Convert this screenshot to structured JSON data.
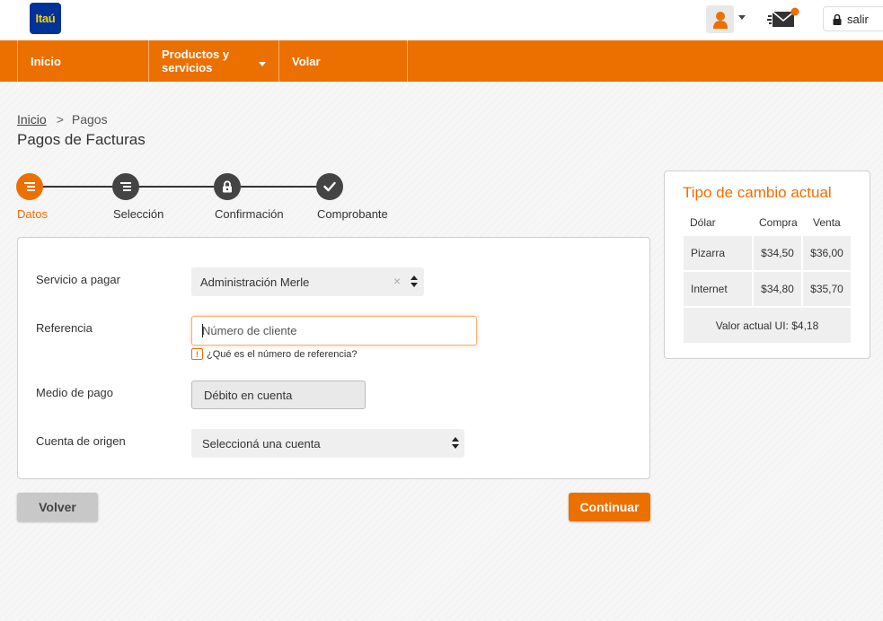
{
  "header": {
    "logo_text": "Itaú",
    "logout_label": "salir",
    "notification_color": "#ec7000"
  },
  "nav": {
    "items": [
      {
        "label": "Inicio"
      },
      {
        "label": "Productos y servicios",
        "has_dropdown": true
      },
      {
        "label": "Volar"
      }
    ]
  },
  "breadcrumb": {
    "home": "Inicio",
    "separator": ">",
    "current": "Pagos"
  },
  "page_title": "Pagos de Facturas",
  "stepper": {
    "steps": [
      {
        "label": "Datos",
        "icon": "list-icon",
        "active": true
      },
      {
        "label": "Selección",
        "icon": "list-icon",
        "active": false
      },
      {
        "label": "Confirmación",
        "icon": "lock-icon",
        "active": false
      },
      {
        "label": "Comprobante",
        "icon": "check-icon",
        "active": false
      }
    ]
  },
  "form": {
    "service_label": "Servicio a pagar",
    "service_value": "Administración Merle",
    "reference_label": "Referencia",
    "reference_placeholder": "Número de cliente",
    "reference_help": "¿Qué es el número de referencia?",
    "payment_method_label": "Medio de pago",
    "payment_method_value": "Débito en cuenta",
    "origin_account_label": "Cuenta de origen",
    "origin_account_value": "Seleccioná una cuenta"
  },
  "actions": {
    "back_label": "Volver",
    "continue_label": "Continuar"
  },
  "exchange": {
    "title": "Tipo de cambio actual",
    "currency": "Dólar",
    "col_buy": "Compra",
    "col_sell": "Venta",
    "rows": [
      {
        "name": "Pizarra",
        "buy": "$34,50",
        "sell": "$36,00"
      },
      {
        "name": "Internet",
        "buy": "$34,80",
        "sell": "$35,70"
      }
    ],
    "ui_value": "Valor actual UI: $4,18"
  },
  "colors": {
    "brand_orange": "#ec7000",
    "logo_blue": "#003399",
    "logo_yellow": "#ffcc00"
  }
}
